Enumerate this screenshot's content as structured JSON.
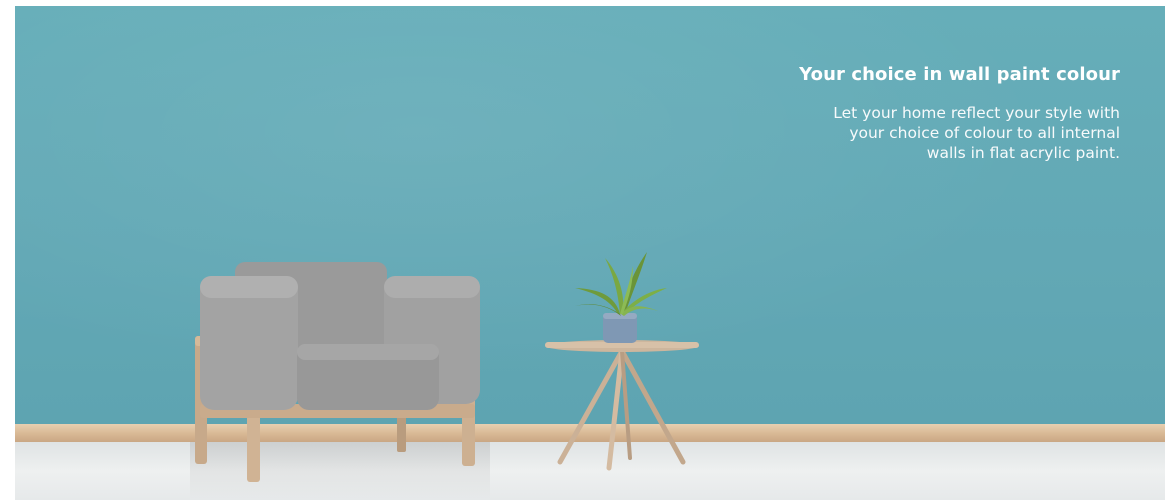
{
  "hero": {
    "title": "Your choice in wall paint colour",
    "body_lines": [
      "Let your home reflect your style with",
      "your choice of colour to all internal",
      "walls in flat acrylic paint."
    ]
  },
  "colors": {
    "wall": "#63a9b6",
    "text": "#ffffff",
    "skirting": "#d8b894",
    "floor": "#e9ecec"
  }
}
